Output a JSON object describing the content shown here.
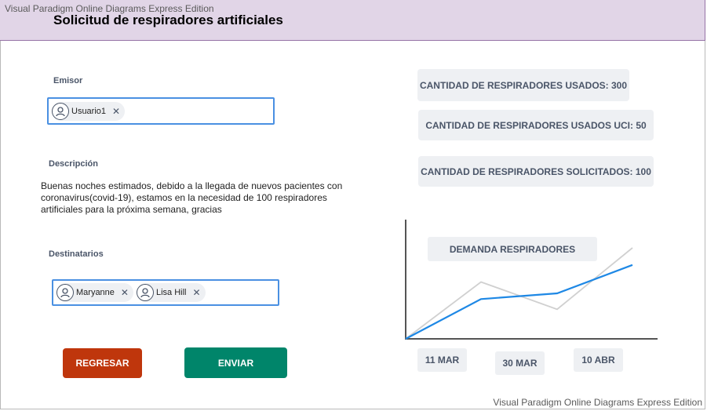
{
  "app": {
    "watermark_top": "Visual Paradigm Online Diagrams Express Edition",
    "watermark_bottom": "Visual Paradigm Online Diagrams Express Edition",
    "title": "Solicitud de respiradores artificiales"
  },
  "form": {
    "sender_label": "Emisor",
    "sender_chip": "Usuario1",
    "description_label": "Descripción",
    "description_text": "Buenas noches estimados, debido a la llegada de nuevos pacientes con\n coronavirus(covid-19), estamos en la necesidad de 100 respiradores\nartificiales para la próxima semana, gracias",
    "recipients_label": "Destinatarios",
    "recipients": [
      "Maryanne",
      "Lisa Hill"
    ],
    "remove_glyph": "✕",
    "back_button": "REGRESAR",
    "send_button": "ENVIAR"
  },
  "stats": {
    "used": "CANTIDAD DE RESPIRADORES USADOS: 300",
    "used_icu": "CANTIDAD DE RESPIRADORES USADOS UCI: 50",
    "requested": "CANTIDAD DE RESPIRADORES SOLICITADOS: 100"
  },
  "colors": {
    "header_bg": "#e1d5e7",
    "field_border": "#4a90e2",
    "back_button": "#bf360c",
    "send_button": "#00856a",
    "series_primary": "#1e88e5",
    "series_secondary": "#d0d0d0"
  },
  "chart_data": {
    "type": "line",
    "title": "DEMANDA RESPIRADORES",
    "x_ticks": [
      "11 MAR",
      "30 MAR",
      "10 ABR"
    ],
    "series": [
      {
        "color": "#1e88e5",
        "values": [
          0,
          35,
          40,
          65
        ]
      },
      {
        "color": "#d0d0d0",
        "values": [
          0,
          50,
          26,
          80
        ]
      }
    ],
    "ylim": [
      0,
      100
    ],
    "grid": false
  }
}
